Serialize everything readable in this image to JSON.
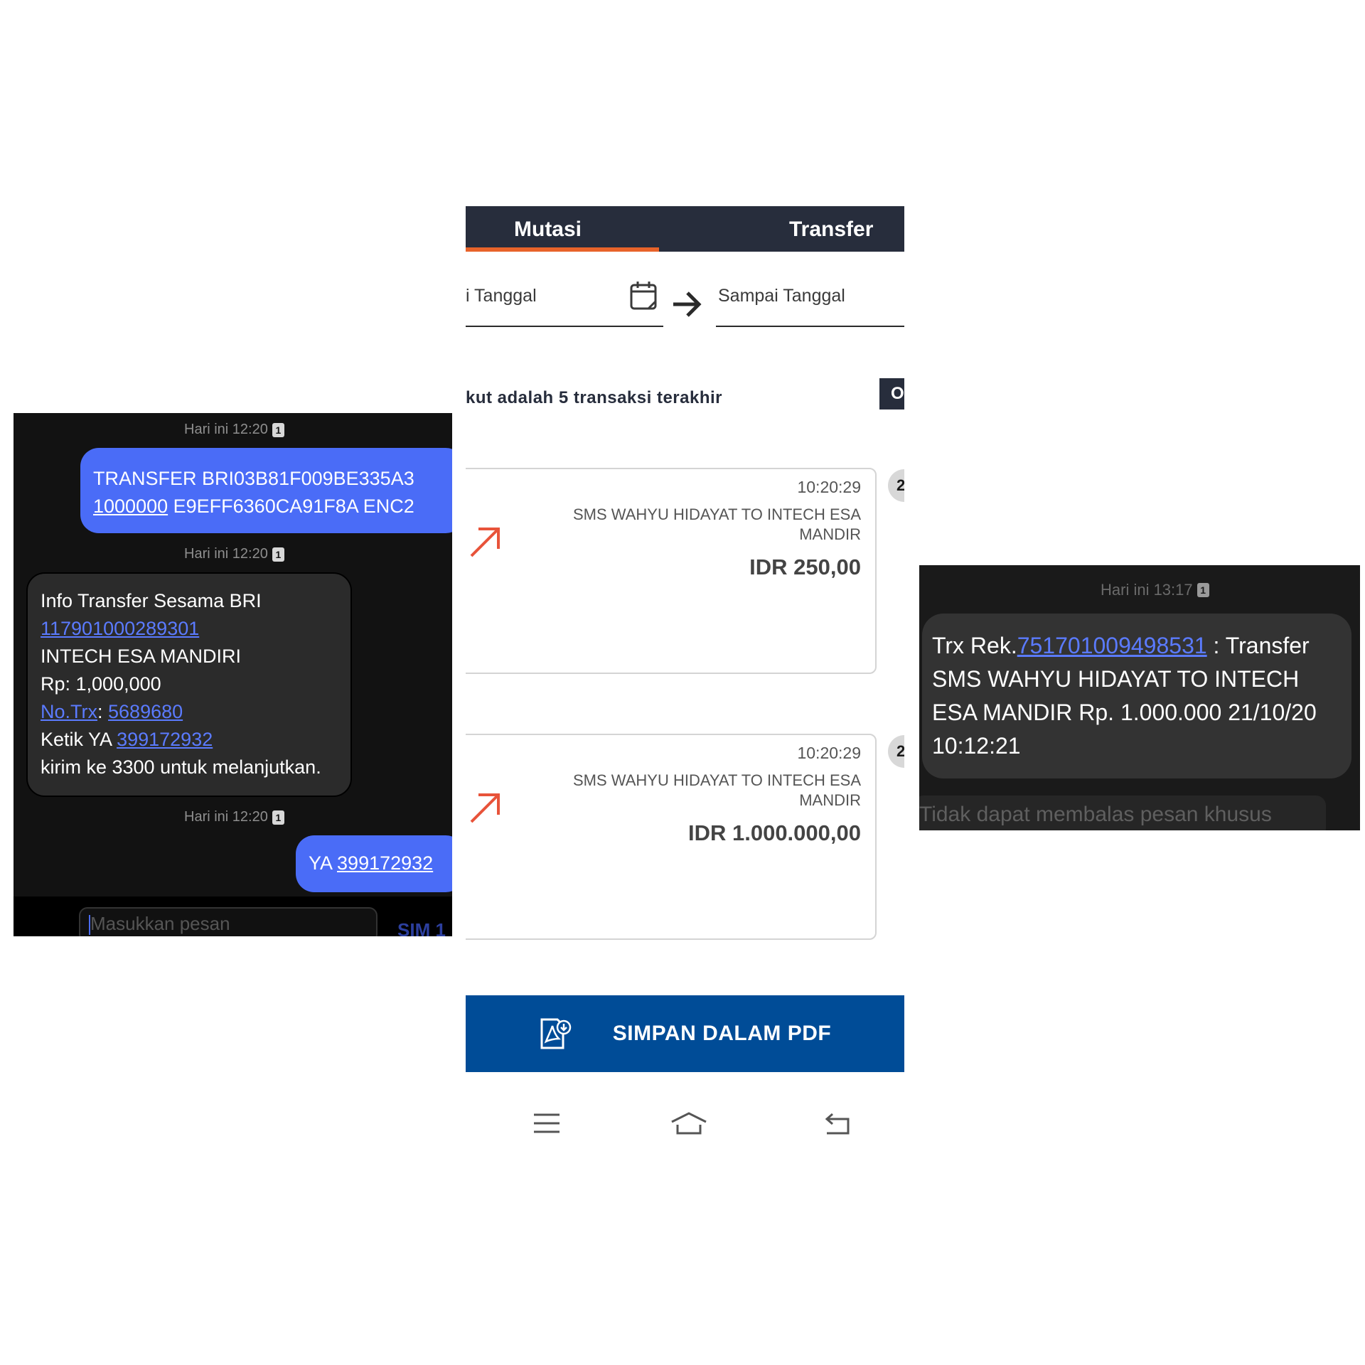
{
  "sms_left": {
    "timestamp_1": "Hari ini 12:20",
    "timestamp_2": "Hari ini 12:20",
    "timestamp_3": "Hari ini 12:20",
    "sim_badge": "1",
    "outgoing_1": {
      "line1": "TRANSFER BRI03B81F009BE335A3",
      "amount_link": "1000000",
      "line2_rest": " E9EFF6360CA91F8A ENC2"
    },
    "incoming": {
      "line1": "Info Transfer Sesama BRI",
      "account_link": "117901000289301",
      "name": "INTECH ESA MANDIRI",
      "amount": "Rp: 1,000,000",
      "trx_label_link": "No.Trx",
      "trx_sep": ": ",
      "trx_number_link": "5689680",
      "ketik_prefix": "Ketik YA ",
      "code_link": "399172932",
      "last_line": "kirim ke 3300 untuk melanjutkan."
    },
    "outgoing_2": {
      "prefix": "YA ",
      "code_link": "399172932"
    },
    "compose_placeholder": "Masukkan pesan",
    "sim_label": "SIM 1"
  },
  "bank": {
    "tab_mutasi": "Mutasi",
    "tab_transfer": "Transfer",
    "from_date": "i Tanggal",
    "to_date": "Sampai Tanggal",
    "info_text": "kut adalah 5 transaksi terakhir",
    "filter_button": "O",
    "transactions": [
      {
        "time": "10:20:29",
        "desc": "SMS  WAHYU HIDAYAT  TO INTECH ESA MANDIR",
        "amount": "IDR 250,00",
        "day_badge": "2"
      },
      {
        "time": "10:20:29",
        "desc": "SMS  WAHYU HIDAYAT  TO INTECH ESA MANDIR",
        "amount": "IDR 1.000.000,00",
        "day_badge": "2"
      }
    ],
    "pdf_button": "SIMPAN DALAM PDF",
    "colors": {
      "tab_bg": "#272d3c",
      "tab_accent": "#e8632a",
      "pdf_button_bg": "#004c97",
      "debit_arrow": "#e8533a"
    }
  },
  "sms_right": {
    "timestamp": "Hari ini 13:17",
    "sim_badge": "1",
    "msg_prefix": "Trx Rek.",
    "account_link": "751701009498531",
    "msg_rest": " :  Transfer SMS  WAHYU HIDAYAT  TO INTECH ESA MANDIR Rp. 1.000.000 21/10/20 10:12:21",
    "no_reply": "Tidak dapat membalas pesan khusus"
  }
}
